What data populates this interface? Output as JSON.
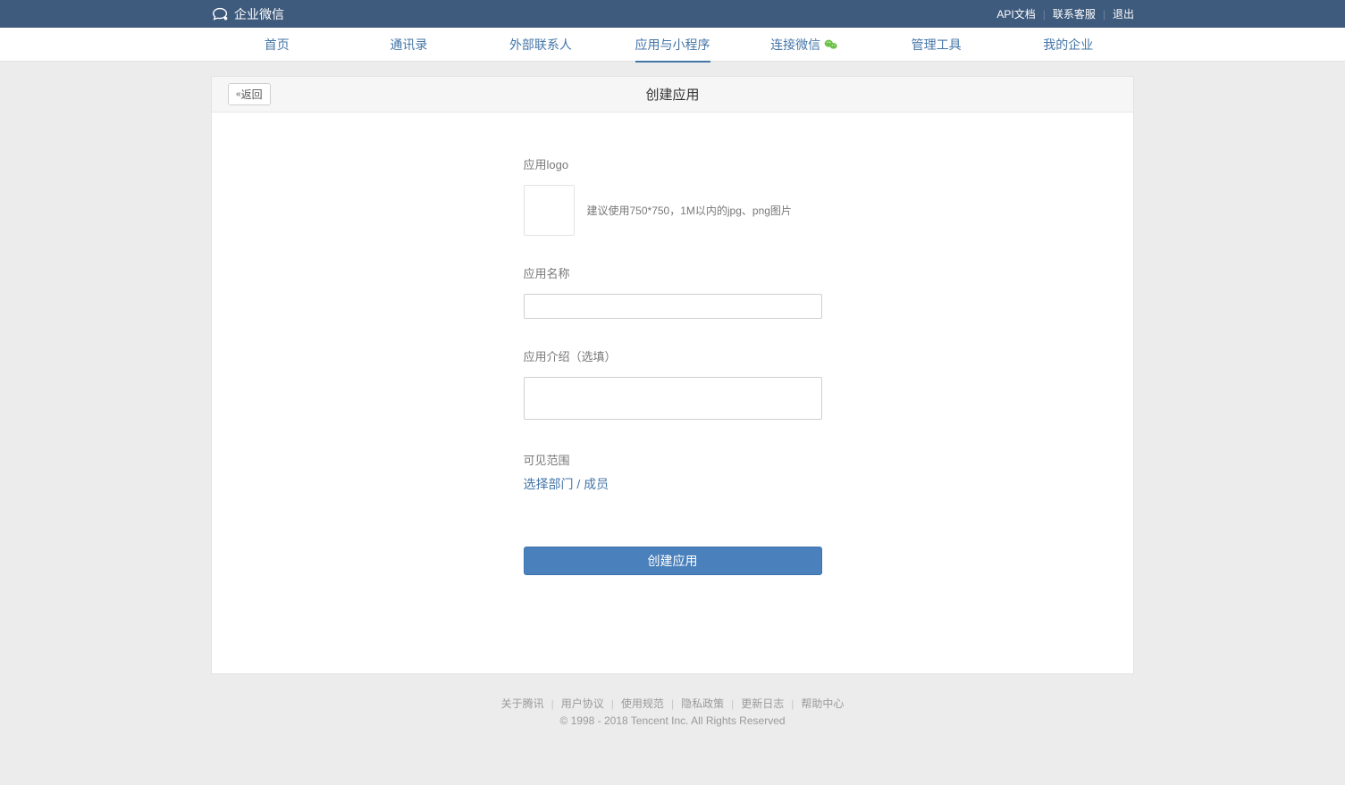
{
  "topbar": {
    "brand": "企业微信",
    "links": [
      "API文档",
      "联系客服",
      "退出"
    ]
  },
  "nav": {
    "items": [
      "首页",
      "通讯录",
      "外部联系人",
      "应用与小程序",
      "连接微信",
      "管理工具",
      "我的企业"
    ],
    "activeIndex": 3,
    "wechatIndex": 4
  },
  "panel": {
    "back": "返回",
    "title": "创建应用"
  },
  "form": {
    "logo_label": "应用logo",
    "logo_hint": "建议使用750*750，1M以内的jpg、png图片",
    "name_label": "应用名称",
    "name_value": "",
    "desc_label": "应用介绍（选填）",
    "desc_value": "",
    "scope_label": "可见范围",
    "scope_link": "选择部门 / 成员",
    "submit": "创建应用"
  },
  "footer": {
    "links": [
      "关于腾讯",
      "用户协议",
      "使用规范",
      "隐私政策",
      "更新日志",
      "帮助中心"
    ],
    "copyright": "© 1998 - 2018 Tencent Inc. All Rights Reserved"
  }
}
